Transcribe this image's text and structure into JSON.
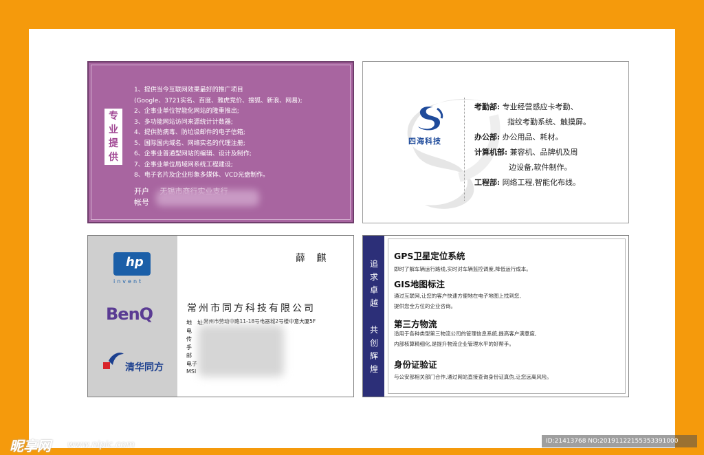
{
  "colors": {
    "background": "#f59a0c",
    "card1": "#a865a0",
    "band": "#2c2f78",
    "brand_blue": "#1f4b9b"
  },
  "card1": {
    "vertical_label": [
      "专",
      "业",
      "提",
      "供"
    ],
    "items": [
      "1、提供当今互联网效果最好的推广项目",
      "(Google、3721实名、百度、雅虎竞价、搜狐、新浪、网易);",
      "2、企事业单位智能化网站的隆重推出;",
      "3、多功能网站访问来源统计计数器;",
      "4、提供防病毒、防垃圾邮件的电子信箱;",
      "5、国际国内域名、网络实名的代理注册;",
      "6、企事业普通型网站的编辑、设计及制作;",
      "7、企事业单位局域网系统工程建设;",
      "8、电子名片及企业形象多媒体、VCD光盘制作。"
    ],
    "bank_label": "开户",
    "bank_value": "无锡市商行实业支行",
    "account_label": "帐号"
  },
  "card2": {
    "company_name": "四海科技",
    "departments": [
      {
        "name": "考勤部:",
        "lines": [
          "专业经营感应卡考勤、",
          "指纹考勤系统、触摸屏。"
        ]
      },
      {
        "name": "办公部:",
        "lines": [
          "办公用品、耗材。"
        ]
      },
      {
        "name": "计算机部:",
        "lines": [
          "兼容机、品牌机及周",
          "边设备,软件制作。"
        ]
      },
      {
        "name": "工程部:",
        "lines": [
          "网络工程,智能化布线。"
        ]
      }
    ]
  },
  "card3": {
    "hp_logo": "hp",
    "hp_tagline": "invent",
    "benq_logo": "BenQ",
    "tsinghua_logo": "清华同方",
    "person": "薛 麒",
    "company": "常州市同方科技有限公司",
    "address_label": "地　址:",
    "address_value": "常州市劳动中路11-18号电器城2号楼中意大厦5F",
    "field_labels": [
      "电",
      "传",
      "手",
      "邮",
      "电子",
      "MSI"
    ]
  },
  "card4": {
    "vertical_text_1": [
      "追",
      "求",
      "卓",
      "越"
    ],
    "vertical_text_2": [
      "共",
      "创",
      "辉",
      "煌"
    ],
    "sections": [
      {
        "title": "GPS卫星定位系统",
        "desc": [
          "即时了解车辆运行路线,实时对车辆监控调度,降低运行成本。"
        ]
      },
      {
        "title": "GIS地图标注",
        "desc": [
          "通过互联网,让您的客户快速方便地在电子地图上找到您,",
          "提供您全方位的企业咨询。"
        ]
      },
      {
        "title": "第三方物流",
        "desc": [
          "适用于各种类型第三物流公司的管理信息系统,提高客户满意度,",
          "内部核算精细化,是提升物流企业管理水平的好帮手。"
        ]
      },
      {
        "title": "身份证验证",
        "desc": [
          "与公安部相关部门合作,通过网站直接查询身份证真伪,让您远离风险。"
        ]
      }
    ]
  },
  "watermark": {
    "brand": "昵享网",
    "url": "www.nipic.com",
    "id_text": "ID:21413768 NO:20191122155353391000"
  }
}
